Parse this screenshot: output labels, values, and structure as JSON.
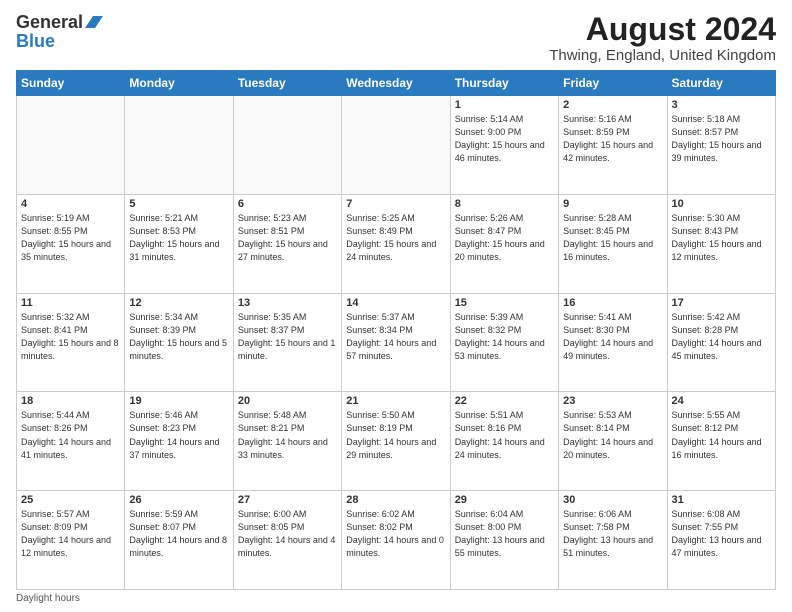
{
  "header": {
    "logo_line1": "General",
    "logo_line2": "Blue",
    "main_title": "August 2024",
    "subtitle": "Thwing, England, United Kingdom"
  },
  "days_of_week": [
    "Sunday",
    "Monday",
    "Tuesday",
    "Wednesday",
    "Thursday",
    "Friday",
    "Saturday"
  ],
  "weeks": [
    [
      {
        "day": "",
        "sunrise": "",
        "sunset": "",
        "daylight": "",
        "empty": true
      },
      {
        "day": "",
        "sunrise": "",
        "sunset": "",
        "daylight": "",
        "empty": true
      },
      {
        "day": "",
        "sunrise": "",
        "sunset": "",
        "daylight": "",
        "empty": true
      },
      {
        "day": "",
        "sunrise": "",
        "sunset": "",
        "daylight": "",
        "empty": true
      },
      {
        "day": "1",
        "sunrise": "Sunrise: 5:14 AM",
        "sunset": "Sunset: 9:00 PM",
        "daylight": "Daylight: 15 hours and 46 minutes.",
        "empty": false
      },
      {
        "day": "2",
        "sunrise": "Sunrise: 5:16 AM",
        "sunset": "Sunset: 8:59 PM",
        "daylight": "Daylight: 15 hours and 42 minutes.",
        "empty": false
      },
      {
        "day": "3",
        "sunrise": "Sunrise: 5:18 AM",
        "sunset": "Sunset: 8:57 PM",
        "daylight": "Daylight: 15 hours and 39 minutes.",
        "empty": false
      }
    ],
    [
      {
        "day": "4",
        "sunrise": "Sunrise: 5:19 AM",
        "sunset": "Sunset: 8:55 PM",
        "daylight": "Daylight: 15 hours and 35 minutes.",
        "empty": false
      },
      {
        "day": "5",
        "sunrise": "Sunrise: 5:21 AM",
        "sunset": "Sunset: 8:53 PM",
        "daylight": "Daylight: 15 hours and 31 minutes.",
        "empty": false
      },
      {
        "day": "6",
        "sunrise": "Sunrise: 5:23 AM",
        "sunset": "Sunset: 8:51 PM",
        "daylight": "Daylight: 15 hours and 27 minutes.",
        "empty": false
      },
      {
        "day": "7",
        "sunrise": "Sunrise: 5:25 AM",
        "sunset": "Sunset: 8:49 PM",
        "daylight": "Daylight: 15 hours and 24 minutes.",
        "empty": false
      },
      {
        "day": "8",
        "sunrise": "Sunrise: 5:26 AM",
        "sunset": "Sunset: 8:47 PM",
        "daylight": "Daylight: 15 hours and 20 minutes.",
        "empty": false
      },
      {
        "day": "9",
        "sunrise": "Sunrise: 5:28 AM",
        "sunset": "Sunset: 8:45 PM",
        "daylight": "Daylight: 15 hours and 16 minutes.",
        "empty": false
      },
      {
        "day": "10",
        "sunrise": "Sunrise: 5:30 AM",
        "sunset": "Sunset: 8:43 PM",
        "daylight": "Daylight: 15 hours and 12 minutes.",
        "empty": false
      }
    ],
    [
      {
        "day": "11",
        "sunrise": "Sunrise: 5:32 AM",
        "sunset": "Sunset: 8:41 PM",
        "daylight": "Daylight: 15 hours and 8 minutes.",
        "empty": false
      },
      {
        "day": "12",
        "sunrise": "Sunrise: 5:34 AM",
        "sunset": "Sunset: 8:39 PM",
        "daylight": "Daylight: 15 hours and 5 minutes.",
        "empty": false
      },
      {
        "day": "13",
        "sunrise": "Sunrise: 5:35 AM",
        "sunset": "Sunset: 8:37 PM",
        "daylight": "Daylight: 15 hours and 1 minute.",
        "empty": false
      },
      {
        "day": "14",
        "sunrise": "Sunrise: 5:37 AM",
        "sunset": "Sunset: 8:34 PM",
        "daylight": "Daylight: 14 hours and 57 minutes.",
        "empty": false
      },
      {
        "day": "15",
        "sunrise": "Sunrise: 5:39 AM",
        "sunset": "Sunset: 8:32 PM",
        "daylight": "Daylight: 14 hours and 53 minutes.",
        "empty": false
      },
      {
        "day": "16",
        "sunrise": "Sunrise: 5:41 AM",
        "sunset": "Sunset: 8:30 PM",
        "daylight": "Daylight: 14 hours and 49 minutes.",
        "empty": false
      },
      {
        "day": "17",
        "sunrise": "Sunrise: 5:42 AM",
        "sunset": "Sunset: 8:28 PM",
        "daylight": "Daylight: 14 hours and 45 minutes.",
        "empty": false
      }
    ],
    [
      {
        "day": "18",
        "sunrise": "Sunrise: 5:44 AM",
        "sunset": "Sunset: 8:26 PM",
        "daylight": "Daylight: 14 hours and 41 minutes.",
        "empty": false
      },
      {
        "day": "19",
        "sunrise": "Sunrise: 5:46 AM",
        "sunset": "Sunset: 8:23 PM",
        "daylight": "Daylight: 14 hours and 37 minutes.",
        "empty": false
      },
      {
        "day": "20",
        "sunrise": "Sunrise: 5:48 AM",
        "sunset": "Sunset: 8:21 PM",
        "daylight": "Daylight: 14 hours and 33 minutes.",
        "empty": false
      },
      {
        "day": "21",
        "sunrise": "Sunrise: 5:50 AM",
        "sunset": "Sunset: 8:19 PM",
        "daylight": "Daylight: 14 hours and 29 minutes.",
        "empty": false
      },
      {
        "day": "22",
        "sunrise": "Sunrise: 5:51 AM",
        "sunset": "Sunset: 8:16 PM",
        "daylight": "Daylight: 14 hours and 24 minutes.",
        "empty": false
      },
      {
        "day": "23",
        "sunrise": "Sunrise: 5:53 AM",
        "sunset": "Sunset: 8:14 PM",
        "daylight": "Daylight: 14 hours and 20 minutes.",
        "empty": false
      },
      {
        "day": "24",
        "sunrise": "Sunrise: 5:55 AM",
        "sunset": "Sunset: 8:12 PM",
        "daylight": "Daylight: 14 hours and 16 minutes.",
        "empty": false
      }
    ],
    [
      {
        "day": "25",
        "sunrise": "Sunrise: 5:57 AM",
        "sunset": "Sunset: 8:09 PM",
        "daylight": "Daylight: 14 hours and 12 minutes.",
        "empty": false
      },
      {
        "day": "26",
        "sunrise": "Sunrise: 5:59 AM",
        "sunset": "Sunset: 8:07 PM",
        "daylight": "Daylight: 14 hours and 8 minutes.",
        "empty": false
      },
      {
        "day": "27",
        "sunrise": "Sunrise: 6:00 AM",
        "sunset": "Sunset: 8:05 PM",
        "daylight": "Daylight: 14 hours and 4 minutes.",
        "empty": false
      },
      {
        "day": "28",
        "sunrise": "Sunrise: 6:02 AM",
        "sunset": "Sunset: 8:02 PM",
        "daylight": "Daylight: 14 hours and 0 minutes.",
        "empty": false
      },
      {
        "day": "29",
        "sunrise": "Sunrise: 6:04 AM",
        "sunset": "Sunset: 8:00 PM",
        "daylight": "Daylight: 13 hours and 55 minutes.",
        "empty": false
      },
      {
        "day": "30",
        "sunrise": "Sunrise: 6:06 AM",
        "sunset": "Sunset: 7:58 PM",
        "daylight": "Daylight: 13 hours and 51 minutes.",
        "empty": false
      },
      {
        "day": "31",
        "sunrise": "Sunrise: 6:08 AM",
        "sunset": "Sunset: 7:55 PM",
        "daylight": "Daylight: 13 hours and 47 minutes.",
        "empty": false
      }
    ]
  ],
  "footer": {
    "label": "Daylight hours"
  }
}
